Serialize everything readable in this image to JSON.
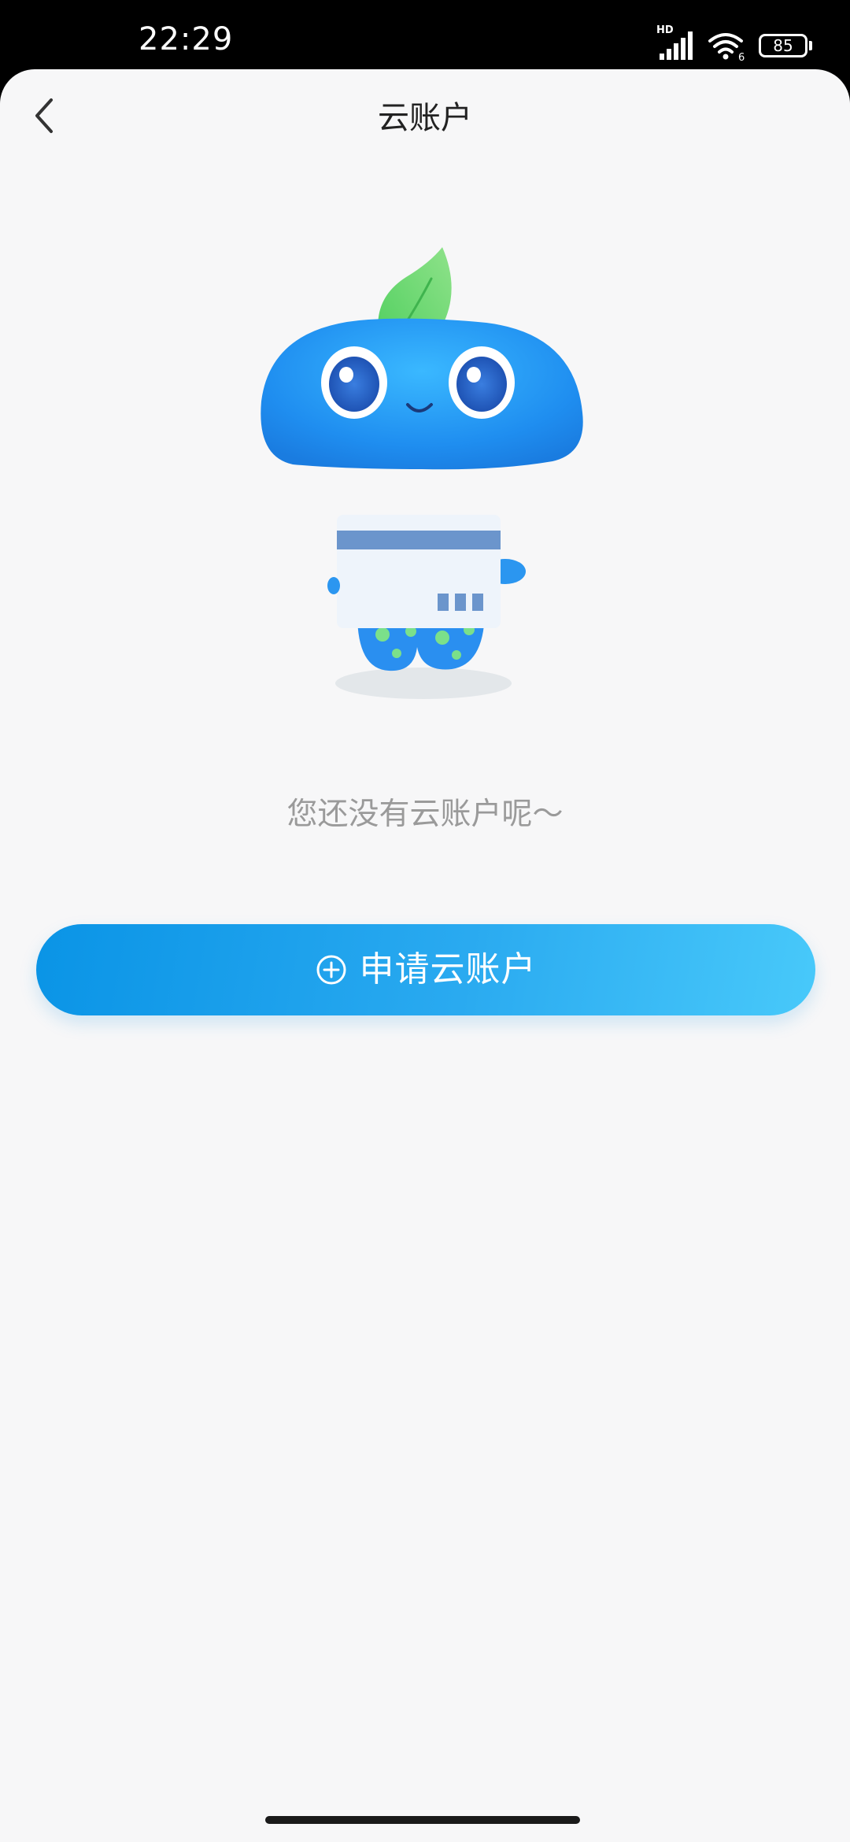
{
  "status_bar": {
    "time": "22:29",
    "network_label": "HD",
    "wifi_badge": "6",
    "battery_level": "85",
    "icons": [
      "signal-icon",
      "wifi-icon",
      "battery-icon"
    ]
  },
  "header": {
    "title": "云账户",
    "back_icon": "chevron-left-icon"
  },
  "empty_state": {
    "illustration": "mascot-with-card",
    "message": "您还没有云账户呢～"
  },
  "apply_button": {
    "label": "申请云账户",
    "icon": "plus-circle-icon"
  },
  "colors": {
    "background": "#f7f7f8",
    "button_gradient_start": "#0a94e6",
    "button_gradient_end": "#48c9fa",
    "title_text": "#222222",
    "message_text": "#9a9a9a"
  }
}
